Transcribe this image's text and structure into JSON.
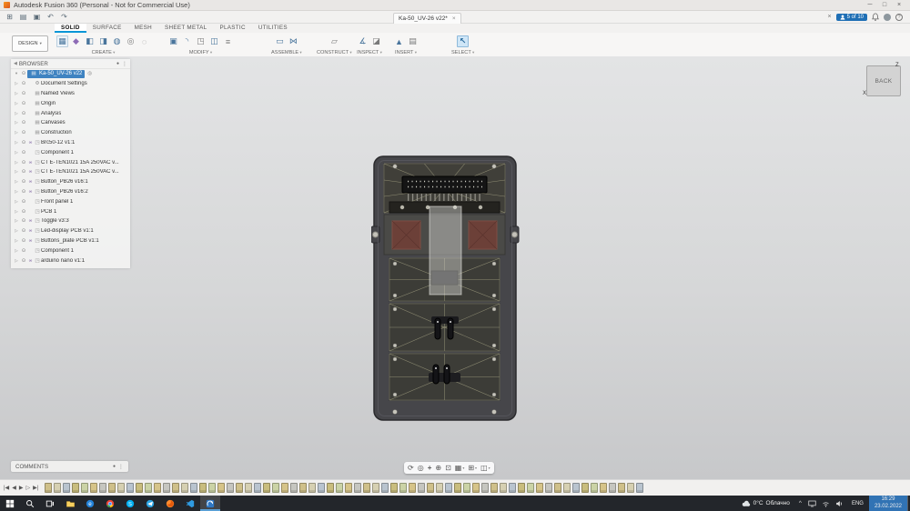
{
  "titlebar": {
    "title": "Autodesk Fusion 360 (Personal - Not for Commercial Use)"
  },
  "quickbar": {
    "doc_tab": "Ka-50_UV-26 v22*",
    "close_tab": "×",
    "user_badge": "5 of 10"
  },
  "ribbon": {
    "design_label": "DESIGN",
    "tabs": [
      {
        "label": "SOLID"
      },
      {
        "label": "SURFACE"
      },
      {
        "label": "MESH"
      },
      {
        "label": "SHEET METAL"
      },
      {
        "label": "PLASTIC"
      },
      {
        "label": "UTILITIES"
      }
    ],
    "groups": [
      {
        "label": "CREATE"
      },
      {
        "label": "MODIFY"
      },
      {
        "label": "ASSEMBLE"
      },
      {
        "label": "CONSTRUCT"
      },
      {
        "label": "INSPECT"
      },
      {
        "label": "INSERT"
      },
      {
        "label": "SELECT"
      }
    ]
  },
  "browser": {
    "header": "BROWSER",
    "root_label": "Ka-50_UV-26 v22",
    "items": [
      {
        "label": "Document Settings",
        "kind": "settings",
        "linked": false
      },
      {
        "label": "Named Views",
        "kind": "folder",
        "linked": false
      },
      {
        "label": "Origin",
        "kind": "folder",
        "linked": false
      },
      {
        "label": "Analysis",
        "kind": "folder",
        "linked": false
      },
      {
        "label": "Canvases",
        "kind": "folder",
        "linked": false
      },
      {
        "label": "Construction",
        "kind": "folder",
        "linked": false
      },
      {
        "label": "Brc50-12 v1:1",
        "kind": "component",
        "linked": true
      },
      {
        "label": "Component 1",
        "kind": "component",
        "linked": false
      },
      {
        "label": "CT E-TEN1021 15A 250VAC v...",
        "kind": "component",
        "linked": true
      },
      {
        "label": "CT E-TEN1021 15A 250VAC v...",
        "kind": "component",
        "linked": true
      },
      {
        "label": "Button_PB26 v16:1",
        "kind": "component",
        "linked": true
      },
      {
        "label": "Button_PB26 v16:2",
        "kind": "component",
        "linked": true
      },
      {
        "label": "Front panel 1",
        "kind": "component",
        "linked": false
      },
      {
        "label": "PCB 1",
        "kind": "component",
        "linked": false
      },
      {
        "label": "Toggle v3:3",
        "kind": "component",
        "linked": true
      },
      {
        "label": "Led-display PCB v1:1",
        "kind": "component",
        "linked": true
      },
      {
        "label": "Buttons_plate PCB v1:1",
        "kind": "component",
        "linked": true
      },
      {
        "label": "Component 1",
        "kind": "component",
        "linked": false
      },
      {
        "label": "arduino nano v1:1",
        "kind": "component",
        "linked": true
      }
    ]
  },
  "viewcube": {
    "face_label": "BACK",
    "axis_z": "Z",
    "axis_x": "X"
  },
  "comments_bar": {
    "label": "COMMENTS"
  },
  "timeline": {
    "feature_count": 66,
    "icon_colors": [
      "#cfc08a",
      "#d6d0b2",
      "#b9c4cf",
      "#c9bd7e",
      "#cbd3a6",
      "#d6c489",
      "#c6c6c0"
    ]
  },
  "taskbar": {
    "weather_temp": "0°C",
    "weather_desc": "Облачно",
    "lang": "ENG",
    "time": "16:29",
    "date": "23.02.2022"
  }
}
